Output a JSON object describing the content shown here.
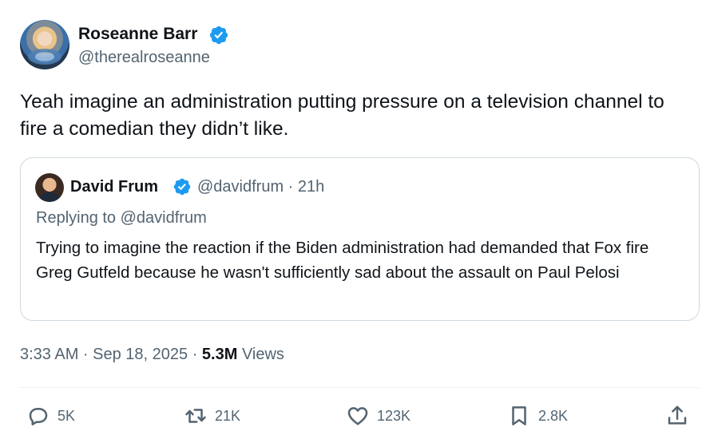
{
  "author": {
    "name": "Roseanne Barr",
    "handle": "@therealroseanne"
  },
  "tweet": {
    "text": "Yeah imagine an administration putting pressure on a television channel to fire a comedian they didn’t like."
  },
  "quote": {
    "name": "David Frum",
    "handle_time": "@davidfrum · 21h",
    "replying_prefix": "Replying to ",
    "replying_handle": "@davidfrum",
    "text": "Trying to imagine the reaction if the Biden administration had demanded that Fox fire Greg Gutfeld because he wasn't sufficiently sad about the assault on Paul Pelosi"
  },
  "meta": {
    "timestamp": "3:33 AM · Sep 18, 2025 · ",
    "views_count": "5.3M",
    "views_label": " Views"
  },
  "actions": {
    "replies": "5K",
    "reposts": "21K",
    "likes": "123K",
    "bookmarks": "2.8K"
  },
  "colors": {
    "verified": "#1d9bf0",
    "secondary_text": "#536471",
    "primary_text": "#0f1419",
    "border": "#cfd9de"
  },
  "icons": {
    "verified": "verified-badge-icon",
    "reply": "speech-bubble-icon",
    "repost": "repost-arrows-icon",
    "like": "heart-icon",
    "bookmark": "bookmark-icon",
    "share": "share-upload-icon"
  }
}
